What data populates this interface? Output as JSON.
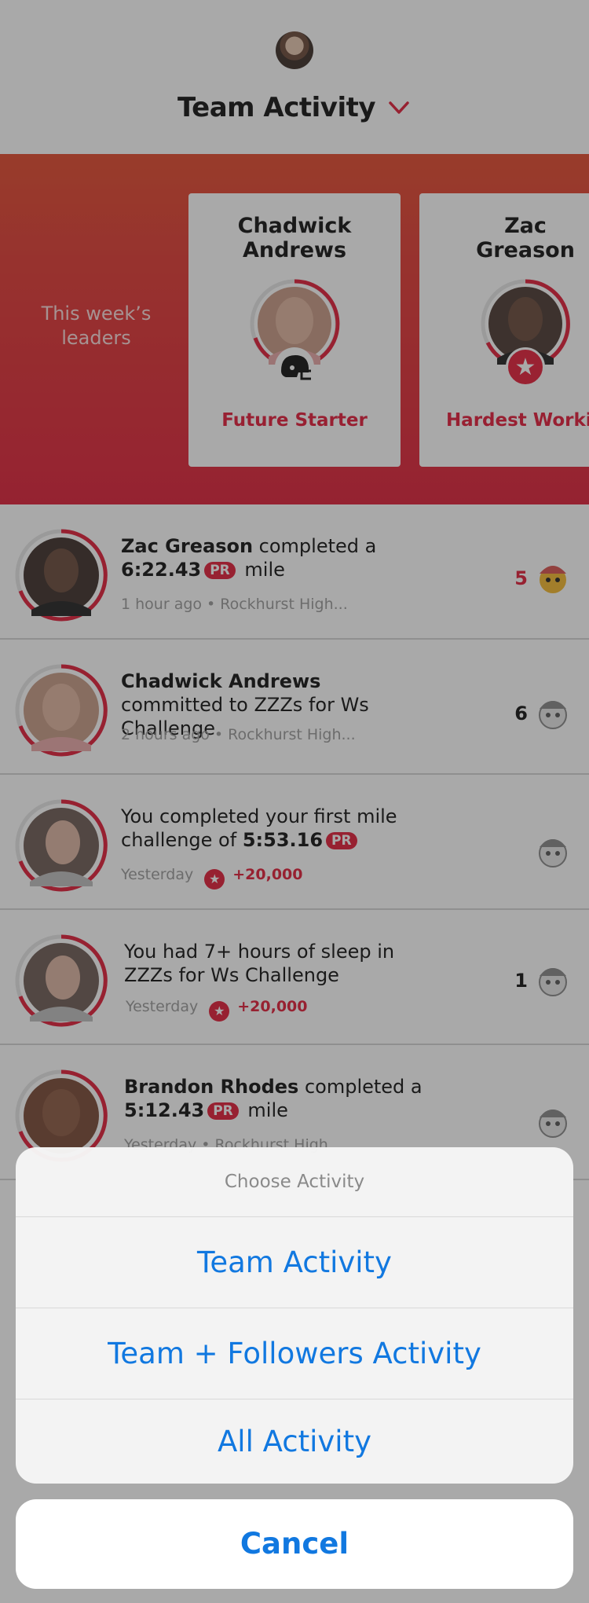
{
  "header": {
    "title": "Team Activity",
    "avatar_icon": "user-avatar",
    "dropdown_icon": "chevron-down-icon",
    "accent": "#e11d38"
  },
  "leaders": {
    "caption": "This week’s leaders",
    "cards": [
      {
        "name_line1": "Chadwick",
        "name_line2": "Andrews",
        "award": "Future Starter",
        "badge_icon": "football-helmet-icon"
      },
      {
        "name_line1": "Zac",
        "name_line2": "Greason",
        "award": "Hardest Workin",
        "badge_icon": "star-badge-icon"
      }
    ]
  },
  "feed": [
    {
      "name": "Zac Greason",
      "text_after_name": " completed a",
      "time": "6:22.43",
      "pr": "PR",
      "text_end": " mile",
      "ago": "1 hour ago",
      "location": "Rockhurst High...",
      "count": "5"
    },
    {
      "name": "Chadwick Andrews",
      "text_after_name": " committed to ZZZs for Ws Challenge",
      "ago": "2 hours ago",
      "location": "Rockhurst High...",
      "count": "6"
    },
    {
      "text_before": "You completed your first mile challenge of ",
      "time": "5:53.16",
      "pr": "PR",
      "ago": "Yesterday",
      "points": "+20,000"
    },
    {
      "text_before": "You had 7+ hours of sleep in ZZZs for Ws Challenge",
      "ago": "Yesterday",
      "points": "+20,000",
      "count": "1"
    },
    {
      "name": "Brandon Rhodes",
      "text_after_name": " completed a",
      "time": "5:12.43",
      "pr": "PR",
      "text_end": " mile",
      "ago": "Yesterday",
      "location": "Rockhurst High"
    }
  ],
  "sheet": {
    "title": "Choose Activity",
    "options": [
      "Team Activity",
      "Team + Followers Activity",
      "All Activity"
    ],
    "cancel": "Cancel",
    "link_color": "#1178e0"
  }
}
